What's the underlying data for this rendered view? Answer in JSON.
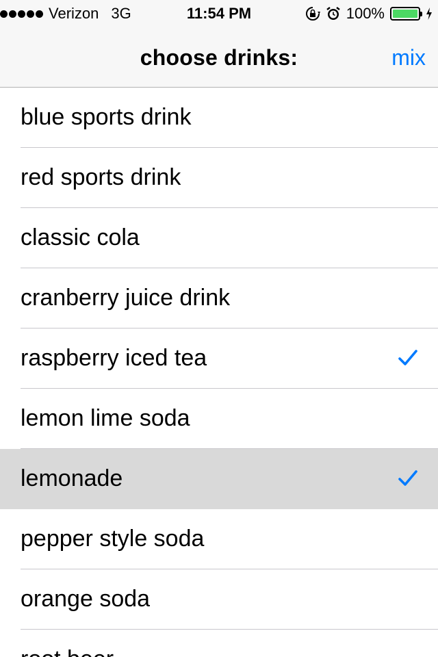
{
  "status_bar": {
    "carrier": "Verizon",
    "network": "3G",
    "time": "11:54 PM",
    "battery": "100%",
    "battery_level": 1.0,
    "signal_bars": 5,
    "icons": [
      "orientation-lock-icon",
      "alarm-icon",
      "battery-icon",
      "charging-bolt-icon"
    ]
  },
  "nav": {
    "title": "choose drinks:",
    "action_label": "mix"
  },
  "colors": {
    "accent": "#007aff",
    "selected_row": "#d9d9d9",
    "battery_fill": "#4cd964"
  },
  "drinks": [
    {
      "label": "blue sports drink",
      "checked": false,
      "highlighted": false
    },
    {
      "label": "red sports drink",
      "checked": false,
      "highlighted": false
    },
    {
      "label": "classic cola",
      "checked": false,
      "highlighted": false
    },
    {
      "label": "cranberry juice drink",
      "checked": false,
      "highlighted": false
    },
    {
      "label": "raspberry iced tea",
      "checked": true,
      "highlighted": false
    },
    {
      "label": "lemon lime soda",
      "checked": false,
      "highlighted": false
    },
    {
      "label": "lemonade",
      "checked": true,
      "highlighted": true
    },
    {
      "label": "pepper style soda",
      "checked": false,
      "highlighted": false
    },
    {
      "label": "orange soda",
      "checked": false,
      "highlighted": false
    },
    {
      "label": "root beer",
      "checked": false,
      "highlighted": false
    }
  ]
}
